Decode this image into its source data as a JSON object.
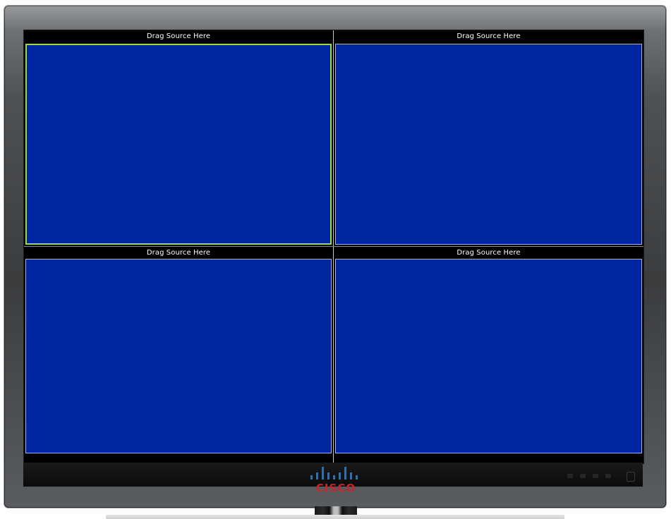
{
  "panes": [
    {
      "label": "Drag Source Here",
      "selected": true
    },
    {
      "label": "Drag Source Here",
      "selected": false
    },
    {
      "label": "Drag Source Here",
      "selected": false
    },
    {
      "label": "Drag Source Here",
      "selected": false
    }
  ],
  "brand": {
    "logo_text": "CISCO",
    "logo_icon": "cisco-bridge-bars-icon",
    "logo_bar_color": "#2a6fb0",
    "logo_text_color": "#d0202a"
  },
  "colors": {
    "pane_background": "#0025a0",
    "selected_border": "#99e033",
    "screen_background": "#000000"
  }
}
